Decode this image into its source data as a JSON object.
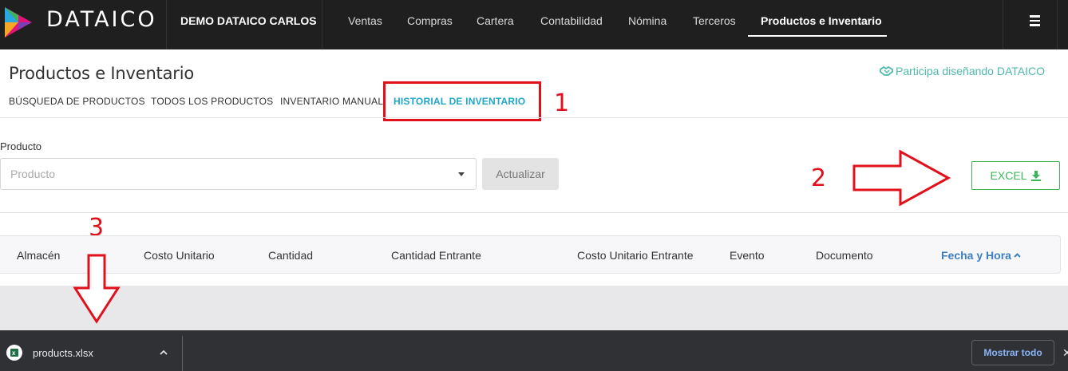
{
  "brand": {
    "name": "DATAICO"
  },
  "header": {
    "company": "DEMO DATAICO CARLOS",
    "nav": [
      "Ventas",
      "Compras",
      "Cartera",
      "Contabilidad",
      "Nómina",
      "Terceros",
      "Productos e Inventario"
    ],
    "active_nav": "Productos e Inventario"
  },
  "page": {
    "title": "Productos e Inventario",
    "participa": "Participa diseñando DATAICO",
    "tabs": [
      "BÚSQUEDA DE PRODUCTOS",
      "TODOS LOS PRODUCTOS",
      "INVENTARIO MANUAL",
      "HISTORIAL DE INVENTARIO"
    ],
    "active_tab": "HISTORIAL DE INVENTARIO"
  },
  "filter": {
    "product_label": "Producto",
    "product_placeholder": "Producto",
    "update_label": "Actualizar",
    "excel_label": "EXCEL"
  },
  "table": {
    "columns": [
      "Almacén",
      "Costo Unitario",
      "Cantidad",
      "Cantidad Entrante",
      "Costo Unitario Entrante",
      "Evento",
      "Documento",
      "Fecha y Hora"
    ],
    "sorted_column": "Fecha y Hora"
  },
  "annotations": {
    "step1": "1",
    "step2": "2",
    "step3": "3"
  },
  "download_bar": {
    "file_name": "products.xlsx",
    "show_all_label": "Mostrar todo",
    "close_glyph": "✕"
  },
  "colors": {
    "topbar": "#1f1f1f",
    "active_tab": "#1ea7c9",
    "excel_green": "#3cb55a",
    "annotation_red": "#e0111b",
    "sort_blue": "#3d7fc1",
    "participa_teal": "#4fb8ab"
  }
}
